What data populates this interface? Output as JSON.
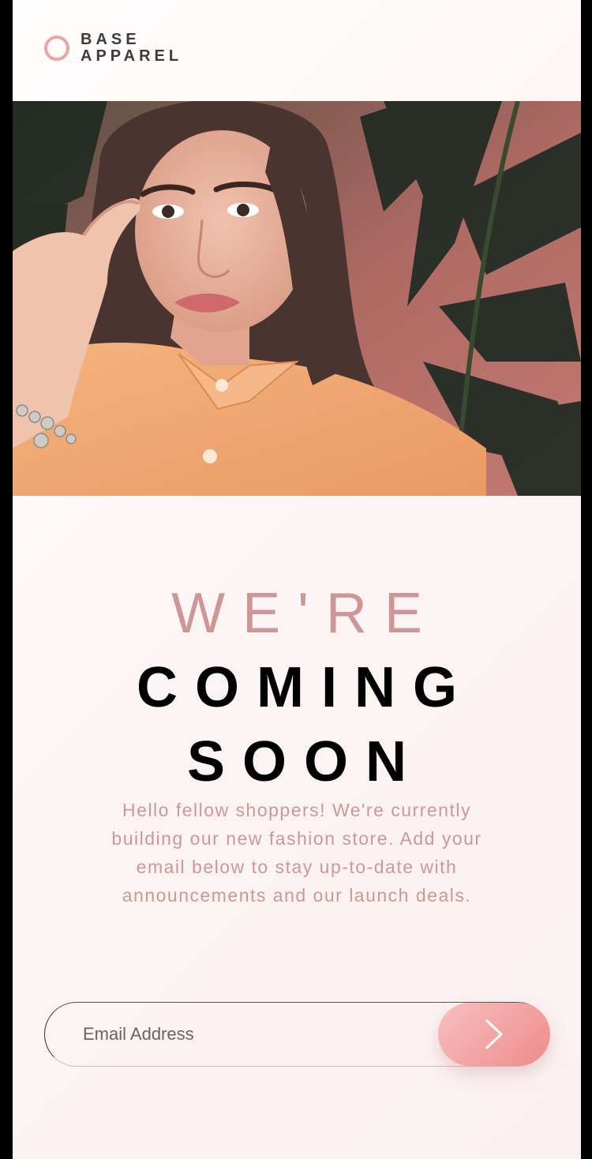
{
  "brand": {
    "name_line1": "BASE",
    "name_line2": "APPAREL",
    "accent_color": "#f0a3a3"
  },
  "hero": {
    "image": "woman-in-orange-shirt-photo"
  },
  "headline": {
    "line1": "WE'RE",
    "line2": "COMING",
    "line3": "SOON"
  },
  "intro": "Hello fellow shoppers! We're currently building our new fashion store. Add your email below to stay up-to-date with announcements and our launch deals.",
  "signup": {
    "email_placeholder": "Email Address",
    "submit_icon": "chevron-right-icon"
  },
  "colors": {
    "desaturated_red": "#ce9797",
    "dark_grayish_red": "#423a3a",
    "button_gradient_start": "#f8bfbf",
    "button_gradient_end": "#ee8b8b"
  }
}
